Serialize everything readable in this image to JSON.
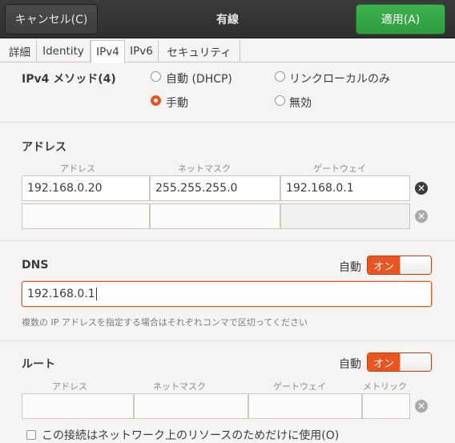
{
  "header": {
    "cancel_label": "キャンセル(C)",
    "title": "有線",
    "apply_label": "適用(A)"
  },
  "tabs": [
    "詳細",
    "Identity",
    "IPv4",
    "IPv6",
    "セキュリティ"
  ],
  "active_tab": "IPv4",
  "method": {
    "label": "IPv4 メソッド(4)",
    "options": [
      "自動 (DHCP)",
      "リンクローカルのみ",
      "手動",
      "無効"
    ],
    "selected": "手動"
  },
  "addresses": {
    "title": "アドレス",
    "columns": [
      "アドレス",
      "ネットマスク",
      "ゲートウェイ"
    ],
    "rows": [
      [
        "192.168.0.20",
        "255.255.255.0",
        "192.168.0.1"
      ],
      [
        "",
        "",
        ""
      ]
    ]
  },
  "dns": {
    "title": "DNS",
    "auto_label": "自動",
    "switch_label": "オン",
    "value": "192.168.0.1",
    "hint": "複数の IP アドレスを指定する場合はそれぞれコンマで区切ってください"
  },
  "routes": {
    "title": "ルート",
    "auto_label": "自動",
    "switch_label": "オン",
    "columns": [
      "アドレス",
      "ネットマスク",
      "ゲートウェイ",
      "メトリック"
    ],
    "checkbox_label": "この接続はネットワーク上のリソースのためだけに使用(O)"
  },
  "colors": {
    "accent": "#e95420",
    "apply_green": "#3eb34f",
    "header_bg": "#333333"
  }
}
